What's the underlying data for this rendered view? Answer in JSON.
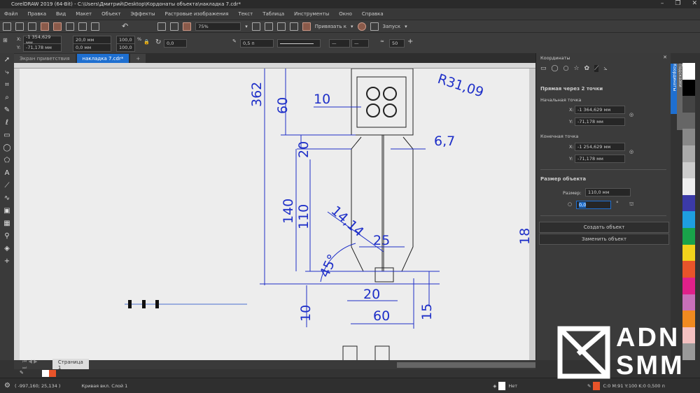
{
  "title": "CorelDRAW 2019 (64-Bit) - C:\\Users\\Дмитрий\\Desktop\\Кордонаты объекта\\накладка 7.cdr*",
  "menu": [
    "Файл",
    "Правка",
    "Вид",
    "Макет",
    "Объект",
    "Эффекты",
    "Растровые изображения",
    "Текст",
    "Таблица",
    "Инструменты",
    "Окно",
    "Справка"
  ],
  "toolbar": {
    "zoom": "75%",
    "snap": "Привязать к",
    "launch": "Запуск"
  },
  "props": {
    "x": "-1 354,629 мм",
    "y": "-71,178 мм",
    "w": "20,0 мм",
    "h": "0,0 мм",
    "sx": "100,0",
    "sy": "100,0",
    "pct": "%",
    "angle": "0,0",
    "outline": "0,5 п",
    "smooth": "50"
  },
  "tabs": {
    "welcome": "Экран приветствия",
    "doc": "накладка 7.cdr*"
  },
  "docker": {
    "title": "Координаты",
    "section": "Прямая через 2 точки",
    "start": "Начальная точка",
    "sx": "-1 364,629 мм",
    "sy": "-71,178 мм",
    "end": "Конечная точка",
    "ex": "-1 254,629 мм",
    "ey": "-71,178 мм",
    "size_title": "Размер объекта",
    "size_label": "Размер:",
    "size": "110,0 мм",
    "angle": "0,0",
    "create": "Создать объект",
    "replace": "Заменить объект",
    "xl": "X:",
    "yl": "Y:"
  },
  "vtabs": {
    "coords": "Координаты",
    "hints": "Подсказки"
  },
  "drawing": {
    "d362": "362",
    "d60a": "60",
    "d10a": "10",
    "r": "R31,09",
    "d67": "6,7",
    "d20a": "20",
    "d140": "140",
    "d110": "110",
    "d1414": "14,14",
    "d25": "25",
    "d45": "45°",
    "d20b": "20",
    "d10b": "10",
    "d60b": "60",
    "d15": "15",
    "d18": "18"
  },
  "page": "Страница 1",
  "status": {
    "coords": "( -997,160; 25,134 )",
    "info": "Кривая вкл. Слой 1",
    "fill": "Нет",
    "outline": "C:0 M:91 Y:100 K:0  0,500 п"
  },
  "logo": {
    "line1": "ADN",
    "line2": "SMM"
  },
  "colors": {
    "accent": "#1e6fd0",
    "dimension": "#1e2fc8",
    "outline": "#e8542a"
  }
}
